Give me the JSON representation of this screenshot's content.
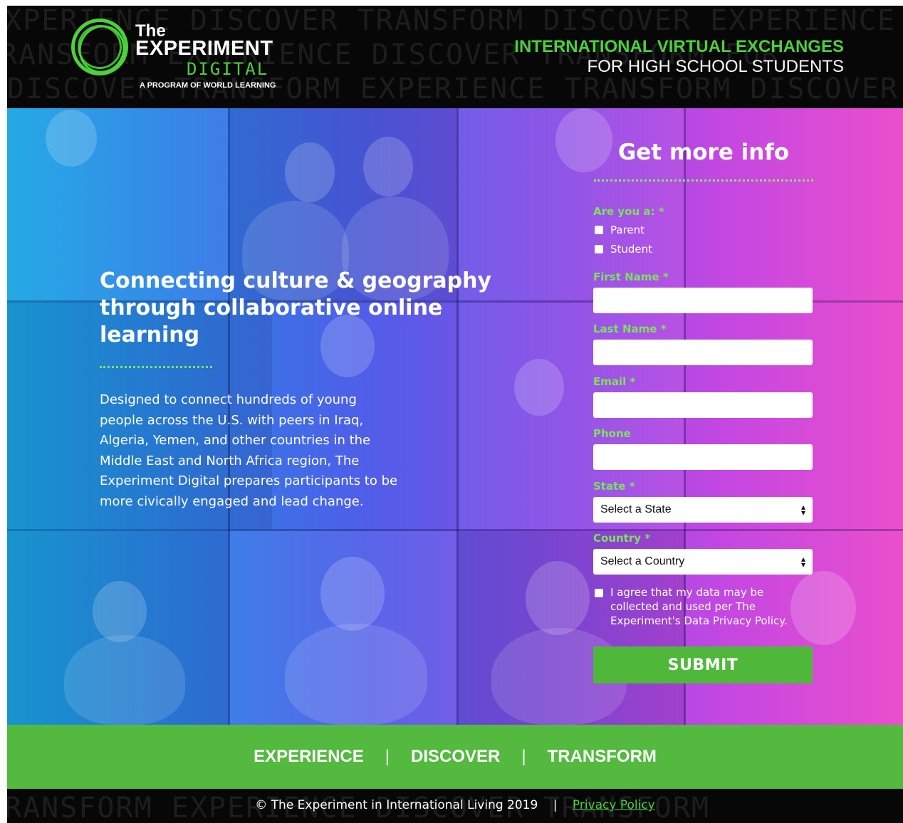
{
  "header": {
    "background_words": [
      "XPERIENCE  DISCOVER  TRANSFORM  DISCOVER  EXPERIENCE",
      "RANSFORM   EXPERIENCE  DISCOVER  TRANSFORM  FOR",
      "DISCOVER  TRANSFORM  EXPERIENCE  TRANSFORM  DISCOVER"
    ],
    "logo": {
      "the": "The",
      "experiment": "EXPERIMENT",
      "digital": "DIGITAL",
      "program": "A PROGRAM OF WORLD LEARNING"
    },
    "tagline_line1": "INTERNATIONAL VIRTUAL EXCHANGES",
    "tagline_line2": "FOR HIGH SCHOOL STUDENTS",
    "accent_color": "#4bd13a"
  },
  "hero": {
    "headline": "Connecting culture & geography through collaborative online learning",
    "description": "Designed to connect hundreds of young people across the U.S. with peers in Iraq, Algeria, Yemen, and other countries in the Middle East and North Africa region, The Experiment Digital prepares participants to be more civically engaged and lead change."
  },
  "form": {
    "title": "Get more info",
    "are_you_label": "Are you a:",
    "options": [
      "Parent",
      "Student"
    ],
    "required_mark": "*",
    "first_name_label": "First Name",
    "last_name_label": "Last Name",
    "email_label": "Email",
    "phone_label": "Phone",
    "state_label": "State",
    "state_value": "Select a State",
    "country_label": "Country",
    "country_value": "Select a Country",
    "agree_text": "I agree that my data may be collected and used per The Experiment's Data Privacy Policy.",
    "submit_label": "SUBMIT",
    "submit_color": "#4fb83a"
  },
  "band": {
    "words": [
      "EXPERIENCE",
      "DISCOVER",
      "TRANSFORM"
    ],
    "separator": "|",
    "color": "#54ba3f"
  },
  "footer": {
    "copyright": "© The Experiment in International Living 2019",
    "separator": "|",
    "privacy_link": "Privacy Policy"
  }
}
